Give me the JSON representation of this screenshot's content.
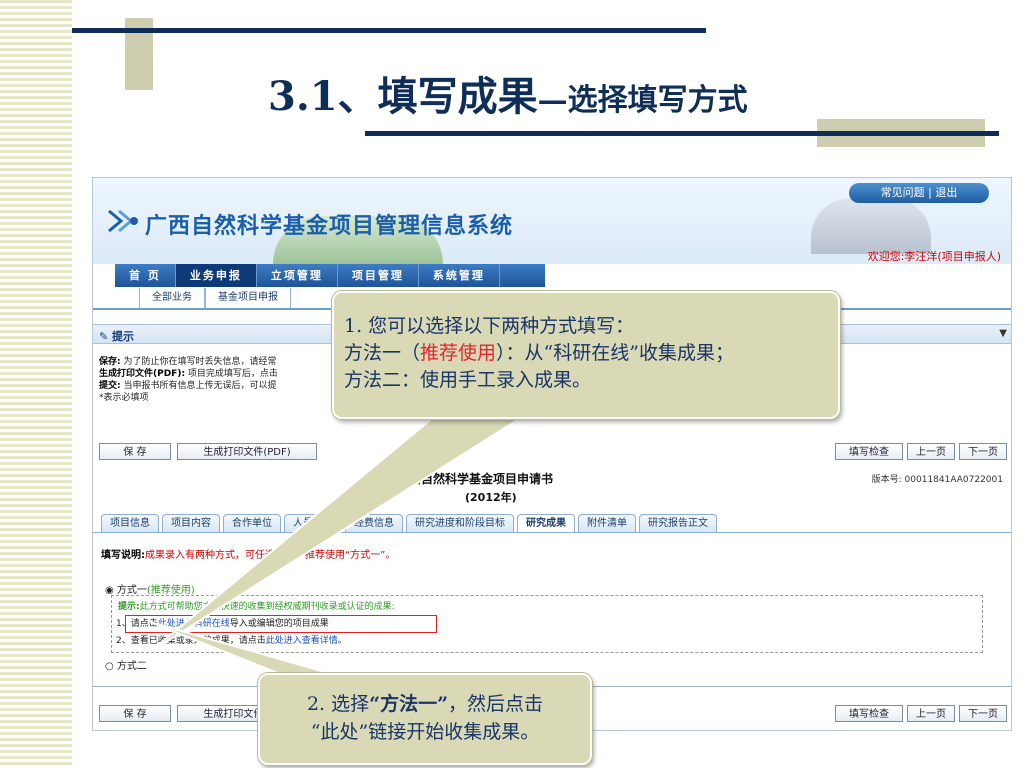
{
  "slide": {
    "title_main": "3.1、填写成果",
    "title_sub": "—选择填写方式"
  },
  "app": {
    "system_title": "广西自然科学基金项目管理信息系统",
    "top_links": "常见问题 | 退出",
    "welcome": "欢迎您:李汪洋(项目申报人)",
    "nav": [
      "首 页",
      "业务申报",
      "立项管理",
      "项目管理",
      "系统管理"
    ],
    "subnav": [
      "全部业务",
      "基金项目申报"
    ],
    "tips_title": "提示",
    "tips_lines": [
      {
        "label": "保存:",
        "text": "为了防止你在填写时丢失信息，请经常"
      },
      {
        "label": "生成打印文件(PDF):",
        "text": "项目完成填写后，点击"
      },
      {
        "label": "提交:",
        "text": "当申报书所有信息上传无误后，可以提"
      },
      {
        "label": "",
        "text": "*表示必填项"
      }
    ],
    "buttons": {
      "save": "保 存",
      "pdf": "生成打印文件(PDF)",
      "check": "填写检查",
      "prev": "上一页",
      "next": "下一页"
    },
    "doc_title": "广西自然科学基金项目申请书",
    "doc_year": "(2012年)",
    "version": "版本号: 00011841AA0722001",
    "tabs": [
      "项目信息",
      "项目内容",
      "合作单位",
      "人员信息",
      "经费信息",
      "研究进度和阶段目标",
      "研究成果",
      "附件清单",
      "研究报告正文"
    ],
    "active_tab": "研究成果",
    "instruction_label": "填写说明:",
    "instruction_text": "成果录入有两种方式，可任选其一，推荐使用“方式一”。",
    "option1_label": "方式一",
    "option1_recommend": "(推荐使用)",
    "hint_label": "提示:",
    "hint_text": "此方式可帮助您方便快速的收集到经权威期刊收录或认证的成果:",
    "step1_prefix": "1、请点击",
    "step1_link": "此处进入科研在线",
    "step1_suffix": "导入或编辑您的项目成果",
    "step2_prefix": "2、查看已收集或录入的成果，请点击",
    "step2_link": "此处进入查看详情。",
    "option2_label": "方式二"
  },
  "callouts": {
    "c1_line1": "1.  您可以选择以下两种方式填写：",
    "c1_line2_a": "方法一（",
    "c1_line2_red": "推荐使用",
    "c1_line2_b": "）：",
    "c1_line2_c": "从“科研在线”收集成果；",
    "c1_line3": "方法二：使用手工录入成果。",
    "c2_a": "2.  选择",
    "c2_bold": "“方法一”",
    "c2_b": "，然后点击",
    "c2_c": "“此处”链接开始收集成果。"
  },
  "colors": {
    "title": "#0f2e57",
    "callout_bg": "#d9d9b6",
    "highlight_red": "#e41f1f",
    "nav_blue": "#1f5398"
  }
}
